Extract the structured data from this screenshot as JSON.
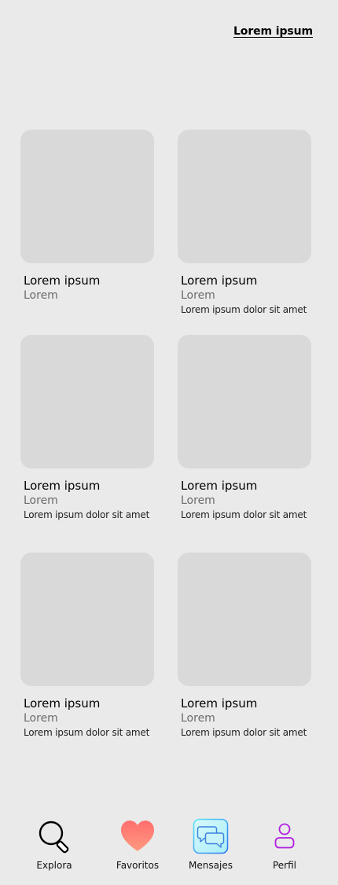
{
  "header": {
    "link_label": "Lorem ipsum"
  },
  "cards": [
    {
      "title": "Lorem ipsum",
      "subtitle": "Lorem",
      "description": ""
    },
    {
      "title": "Lorem ipsum",
      "subtitle": "Lorem",
      "description": "Lorem ipsum dolor sit amet"
    },
    {
      "title": "Lorem ipsum",
      "subtitle": "Lorem",
      "description": "Lorem ipsum dolor sit amet"
    },
    {
      "title": "Lorem ipsum",
      "subtitle": "Lorem",
      "description": "Lorem ipsum dolor sit amet"
    },
    {
      "title": "Lorem ipsum",
      "subtitle": "Lorem",
      "description": "Lorem ipsum dolor sit amet"
    },
    {
      "title": "Lorem ipsum",
      "subtitle": "Lorem",
      "description": "Lorem ipsum dolor sit amet"
    }
  ],
  "nav": {
    "items": [
      {
        "label": "Explora",
        "icon": "search-icon"
      },
      {
        "label": "Favoritos",
        "icon": "heart-icon"
      },
      {
        "label": "Mensajes",
        "icon": "chat-icon"
      },
      {
        "label": "Perfil",
        "icon": "user-icon"
      }
    ]
  },
  "colors": {
    "background": "#EAEAEA",
    "placeholder": "#D9D9D9",
    "heart_gradient": [
      "#FF8A80",
      "#FF6B6B"
    ],
    "chat_gradient": [
      "#5EE7F5",
      "#2E6FF2"
    ],
    "profile_accent": "#B020E0"
  }
}
